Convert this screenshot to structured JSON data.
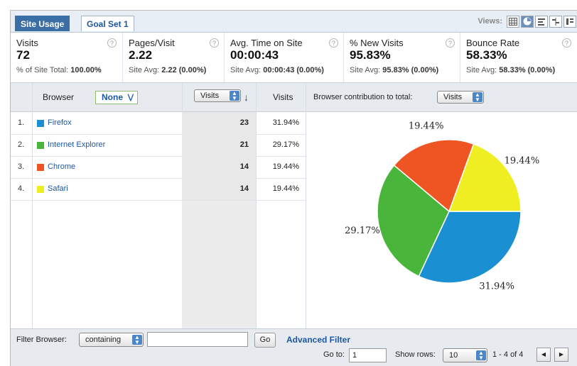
{
  "tabs": [
    {
      "label": "Site Usage",
      "active": true
    },
    {
      "label": "Goal Set 1",
      "active": false
    }
  ],
  "views": {
    "label": "Views:",
    "icons": [
      "table-view-icon",
      "pie-view-icon",
      "performance-view-icon",
      "comparison-view-icon",
      "pivot-view-icon"
    ]
  },
  "metrics": [
    {
      "title": "Visits",
      "value": "72",
      "sub_prefix": "% of Site Total:",
      "sub_value": "100.00%"
    },
    {
      "title": "Pages/Visit",
      "value": "2.22",
      "sub_prefix": "Site Avg:",
      "sub_value": "2.22 (0.00%)"
    },
    {
      "title": "Avg. Time on Site",
      "value": "00:00:43",
      "sub_prefix": "Site Avg:",
      "sub_value": "00:00:43 (0.00%)"
    },
    {
      "title": "% New Visits",
      "value": "95.83%",
      "sub_prefix": "Site Avg:",
      "sub_value": "95.83% (0.00%)"
    },
    {
      "title": "Bounce Rate",
      "value": "58.33%",
      "sub_prefix": "Site Avg:",
      "sub_value": "58.33% (0.00%)"
    }
  ],
  "table": {
    "col_browser": "Browser",
    "secondary_dim": "None",
    "sort_select": "Visits",
    "col_visits": "Visits",
    "contribution_label": "Browser contribution to total:",
    "contribution_select": "Visits",
    "rows": [
      {
        "num": "1.",
        "name": "Firefox",
        "visits": "23",
        "pct": "31.94%",
        "color": "#1a8fd1"
      },
      {
        "num": "2.",
        "name": "Internet Explorer",
        "visits": "21",
        "pct": "29.17%",
        "color": "#49b63b"
      },
      {
        "num": "3.",
        "name": "Chrome",
        "visits": "14",
        "pct": "19.44%",
        "color": "#ee5522"
      },
      {
        "num": "4.",
        "name": "Safari",
        "visits": "14",
        "pct": "19.44%",
        "color": "#eeee22"
      }
    ]
  },
  "chart_data": {
    "type": "pie",
    "categories": [
      "Firefox",
      "Internet Explorer",
      "Chrome",
      "Safari"
    ],
    "values": [
      31.94,
      29.17,
      19.44,
      19.44
    ],
    "labels": [
      "31.94%",
      "29.17%",
      "19.44%",
      "19.44%"
    ],
    "colors": [
      "#1a8fd1",
      "#49b63b",
      "#ee5522",
      "#eeee22"
    ]
  },
  "footer": {
    "filter_label": "Filter Browser:",
    "filter_mode": "containing",
    "filter_value": "",
    "go_label": "Go",
    "advanced_filter": "Advanced Filter",
    "goto_label": "Go to:",
    "goto_value": "1",
    "show_rows_label": "Show rows:",
    "show_rows_value": "10",
    "range": "1 - 4 of 4"
  }
}
